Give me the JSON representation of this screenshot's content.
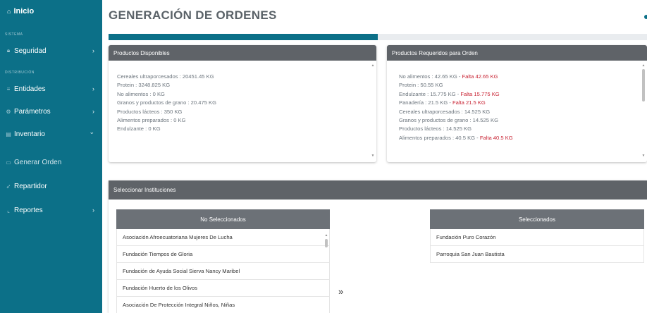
{
  "sidebar": {
    "home_label": "Inicio",
    "sections": {
      "sistema": "SISTEMA",
      "distribucion": "DISTRIBUCIÓN"
    },
    "items": [
      {
        "label": "Seguridad",
        "icon": "lock-icon",
        "has_arrow": true
      },
      {
        "label": "Entidades",
        "icon": "list-icon",
        "has_arrow": true
      },
      {
        "label": "Parámetros",
        "icon": "sliders-icon",
        "has_arrow": true
      },
      {
        "label": "Inventario",
        "icon": "box-icon",
        "has_arrow": true,
        "expanded": true
      },
      {
        "label": "Generar Orden",
        "icon": "order-icon",
        "has_arrow": false
      },
      {
        "label": "Repartidor",
        "icon": "send-icon",
        "has_arrow": false
      },
      {
        "label": "Reportes",
        "icon": "chart-icon",
        "has_arrow": true
      }
    ],
    "arrow_right": "›",
    "arrow_down": "⌄",
    "background": "#0c7088"
  },
  "page": {
    "title": "GENERACIÓN DE ORDENES",
    "progress_fraction": 0.5
  },
  "disponibles": {
    "title": "Productos Disponibles",
    "rows": [
      "Cereales ultraporcesados : 20451.45 KG",
      "Protein : 3248.825 KG",
      "No alimentos : 0 KG",
      "Granos y productos de grano : 20.475 KG",
      "Productos lácteos : 350 KG",
      "Alimentos preparados : 0 KG",
      "Endulzante : 0 KG"
    ]
  },
  "requeridos": {
    "title": "Productos Requeridos para Orden",
    "rows": [
      {
        "text": "No alimentos : 42.65 KG - ",
        "falta": "Falta 42.65 KG"
      },
      {
        "text": "Protein : 50.55 KG",
        "falta": ""
      },
      {
        "text": "Endulzante : 15.775 KG - ",
        "falta": "Falta 15.775 KG"
      },
      {
        "text": "Panadería : 21.5 KG - ",
        "falta": "Falta 21.5 KG"
      },
      {
        "text": "Cereales ultraporcesados : 14.525 KG",
        "falta": ""
      },
      {
        "text": "Granos y productos de grano : 14.525 KG",
        "falta": ""
      },
      {
        "text": "Productos lácteos : 14.525 KG",
        "falta": ""
      },
      {
        "text": "Alimentos preparados : 40.5 KG - ",
        "falta": "Falta 40.5 KG"
      }
    ]
  },
  "instituciones": {
    "title": "Seleccionar Instituciones",
    "no_seleccionados_header": "No Seleccionados",
    "seleccionados_header": "Seleccionados",
    "no_seleccionados": [
      "Asociación Afroecuatoriana Mujeres De Lucha",
      "Fundación Tiempos de Gloria",
      "Fundación de Ayuda Social Sierva Nancy Maribel",
      "Fundación Huerto de los Olivos",
      "Asociación De Protección Integral Niños, Niñas"
    ],
    "seleccionados": [
      "Fundación Puro Corazón",
      "Parroquia San Juan Bautista"
    ],
    "move_glyph": "»"
  },
  "colors": {
    "falta": "#c82333",
    "header_gray": "#5f6368",
    "accent": "#0c7088"
  }
}
